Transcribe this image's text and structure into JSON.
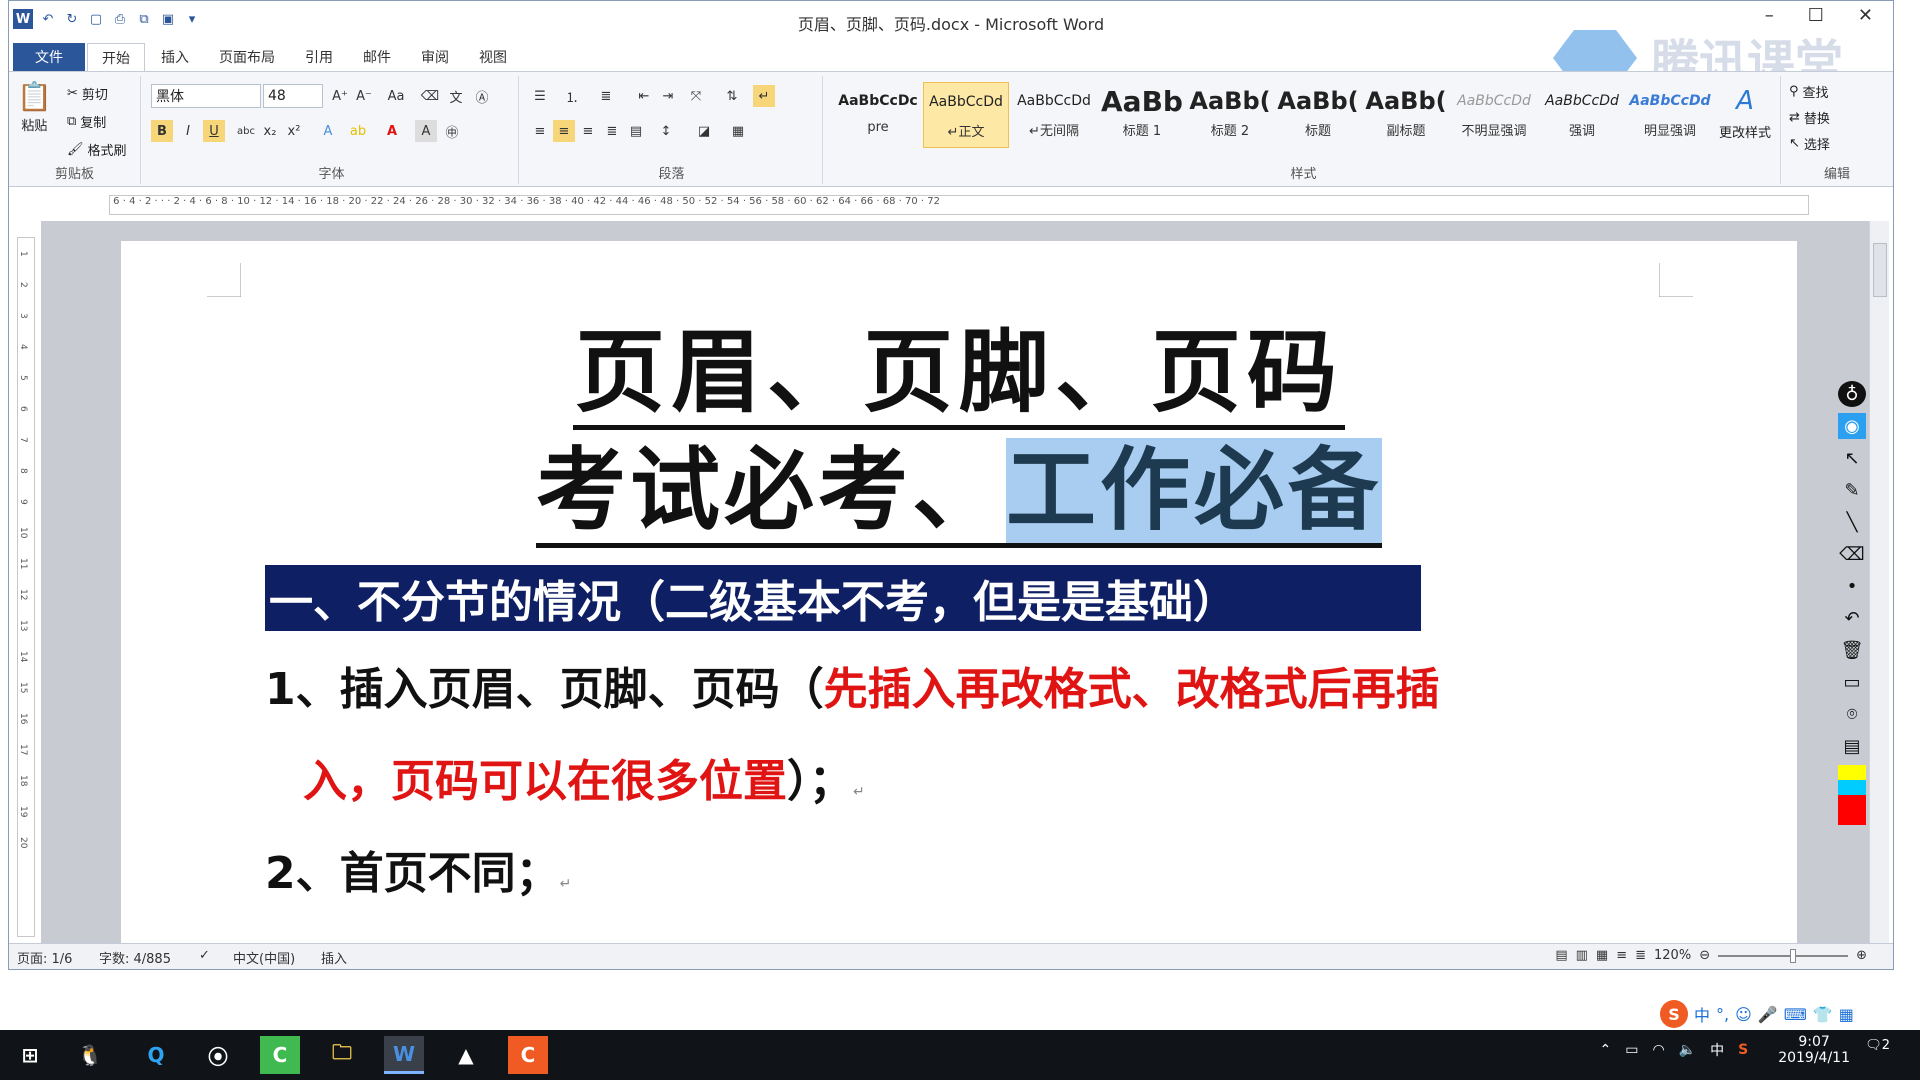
{
  "window": {
    "title": "页眉、页脚、页码.docx - Microsoft Word",
    "minimize": "–",
    "maximize": "☐",
    "close": "✕"
  },
  "tabs": [
    "文件",
    "开始",
    "插入",
    "页面布局",
    "引用",
    "邮件",
    "审阅",
    "视图"
  ],
  "ribbon": {
    "clipboard": {
      "paste": "粘贴",
      "cut": "剪切",
      "copy": "复制",
      "format_painter": "格式刷",
      "label": "剪贴板"
    },
    "font": {
      "name": "黑体",
      "size": "48",
      "label": "字体"
    },
    "paragraph": {
      "label": "段落"
    },
    "styles": {
      "label": "样式",
      "items": [
        {
          "preview": "AaBbCcDc",
          "name": "pre"
        },
        {
          "preview": "AaBbCcDd",
          "name": "↵正文"
        },
        {
          "preview": "AaBbCcDd",
          "name": "↵无间隔"
        },
        {
          "preview": "AaBb",
          "name": "标题 1"
        },
        {
          "preview": "AaBb(",
          "name": "标题 2"
        },
        {
          "preview": "AaBb(",
          "name": "标题"
        },
        {
          "preview": "AaBb(",
          "name": "副标题"
        },
        {
          "preview": "AaBbCcDd",
          "name": "不明显强调"
        },
        {
          "preview": "AaBbCcDd",
          "name": "强调"
        },
        {
          "preview": "AaBbCcDd",
          "name": "明显强调"
        }
      ],
      "change": "更改样式"
    },
    "editing": {
      "find": "查找",
      "replace": "替换",
      "select": "选择",
      "label": "编辑"
    }
  },
  "watermark": "腾讯课堂",
  "document": {
    "title_line1": "页眉、页脚、页码",
    "title_line2_plain": "考试必考、",
    "title_line2_highlight": "工作必备",
    "heading": "一、不分节的情况（二级基本不考，但是是基础）",
    "item1_black": "1、插入页眉、页脚、页码（",
    "item1_red": "先插入再改格式、改格式后再插",
    "item1_cont_red": "入，页码可以在很多位置",
    "item1_cont_black": "）；",
    "item2": "2、首页不同；",
    "para_mark": "↵"
  },
  "status": {
    "page": "页面: 1/6",
    "words": "字数: 4/885",
    "lang": "中文(中国)",
    "mode": "插入",
    "zoom": "120%"
  },
  "ime": {
    "label": "中",
    "punct": "°,"
  },
  "taskbar": {
    "time": "9:07",
    "date": "2019/4/11",
    "ime_tray": "中",
    "notification_count": "2"
  }
}
